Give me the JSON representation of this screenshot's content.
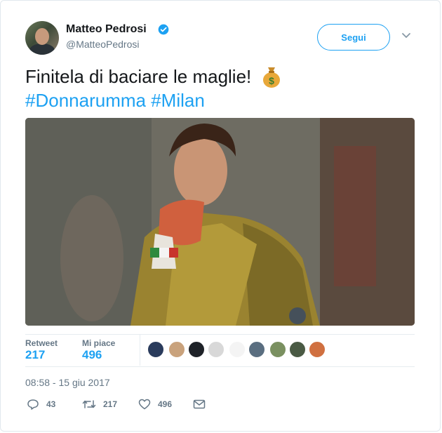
{
  "author": {
    "name": "Matteo Pedrosi",
    "handle": "@MatteoPedrosi",
    "verified": true
  },
  "follow_button": {
    "label": "Segui"
  },
  "tweet": {
    "text": "Finitela di baciare le maglie!",
    "emoji": "money-bag",
    "hashtags": "#Donnarumma #Milan"
  },
  "media": {
    "description_icon": "photo-goalkeeper-kissing-jersey"
  },
  "stats": {
    "retweets_label": "Retweet",
    "retweets_value": "217",
    "likes_label": "Mi piace",
    "likes_value": "496"
  },
  "timestamp": "08:58 - 15 giu 2017",
  "actions": {
    "reply_count": "43",
    "retweet_count": "217",
    "like_count": "496"
  },
  "colors": {
    "accent": "#1da1f2",
    "muted": "#657786",
    "text": "#14171a",
    "border": "#e1e8ed"
  }
}
